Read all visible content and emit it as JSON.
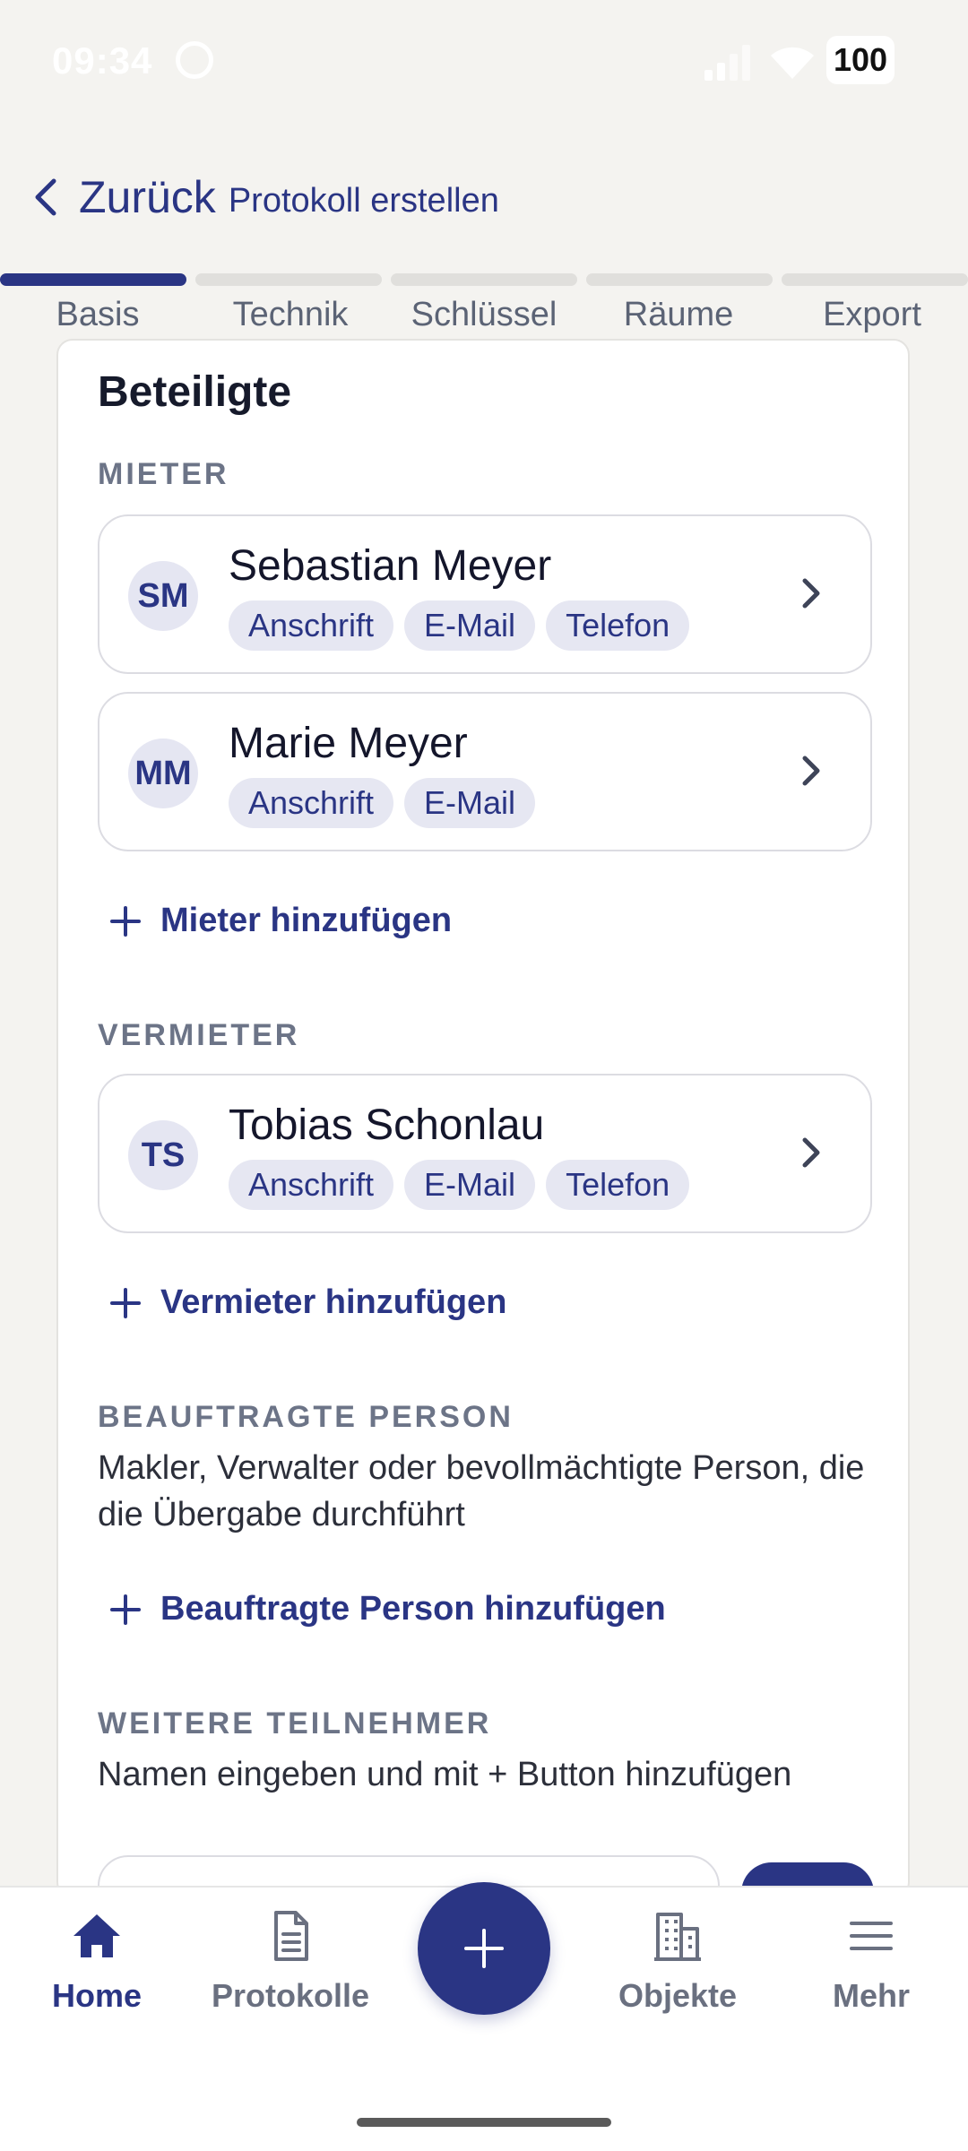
{
  "status_bar": {
    "time": "09:34",
    "battery": "100"
  },
  "header": {
    "back_label": "Zurück",
    "title": "Protokoll erstellen"
  },
  "stepper": {
    "steps": [
      {
        "label": "Basis",
        "active": true
      },
      {
        "label": "Technik",
        "active": false
      },
      {
        "label": "Schlüssel",
        "active": false
      },
      {
        "label": "Räume",
        "active": false
      },
      {
        "label": "Export",
        "active": false
      }
    ]
  },
  "card": {
    "heading": "Beteiligte",
    "tenants": {
      "label": "MIETER",
      "people": [
        {
          "initials": "SM",
          "name": "Sebastian Meyer",
          "tags": [
            "Anschrift",
            "E-Mail",
            "Telefon"
          ]
        },
        {
          "initials": "MM",
          "name": "Marie Meyer",
          "tags": [
            "Anschrift",
            "E-Mail"
          ]
        }
      ],
      "add_label": "Mieter hinzufügen"
    },
    "landlords": {
      "label": "VERMIETER",
      "people": [
        {
          "initials": "TS",
          "name": "Tobias Schonlau",
          "tags": [
            "Anschrift",
            "E-Mail",
            "Telefon"
          ]
        }
      ],
      "add_label": "Vermieter hinzufügen"
    },
    "agent": {
      "label": "BEAUFTRAGTE PERSON",
      "description": "Makler, Verwalter oder bevollmächtigte Person, die die Übergabe durchführt",
      "add_label": "Beauftragte Person hinzufügen"
    },
    "participants": {
      "label": "WEITERE TEILNEHMER",
      "description": "Namen eingeben und mit + Button hinzufügen"
    }
  },
  "bottom_nav": {
    "items": [
      {
        "label": "Home",
        "icon": "home-icon",
        "active": true
      },
      {
        "label": "Protokolle",
        "icon": "document-icon",
        "active": false
      },
      {
        "label": "Objekte",
        "icon": "building-icon",
        "active": false
      },
      {
        "label": "Mehr",
        "icon": "menu-icon",
        "active": false
      }
    ]
  },
  "colors": {
    "accent": "#2a3584",
    "tag_bg": "#e6e7f2",
    "background": "#f4f3f0"
  }
}
